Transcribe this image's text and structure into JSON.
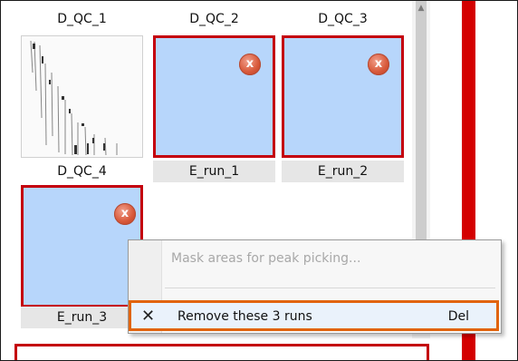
{
  "runs": [
    {
      "label": "D_QC_1"
    },
    {
      "label": "D_QC_2"
    },
    {
      "label": "D_QC_3"
    },
    {
      "label": "D_QC_4"
    },
    {
      "label": "E_run_1"
    },
    {
      "label": "E_run_2"
    },
    {
      "label": "E_run_3"
    }
  ],
  "close_glyph": "x",
  "context_menu": {
    "mask_label": "Mask areas for peak picking...",
    "remove_label": "Remove these 3 runs",
    "remove_shortcut": "Del",
    "remove_icon_glyph": "✕"
  },
  "colors": {
    "selection_fill": "#b7d6fb",
    "selection_border": "#c4000d",
    "highlight_border": "#e1640e",
    "side_bar": "#d40000"
  }
}
